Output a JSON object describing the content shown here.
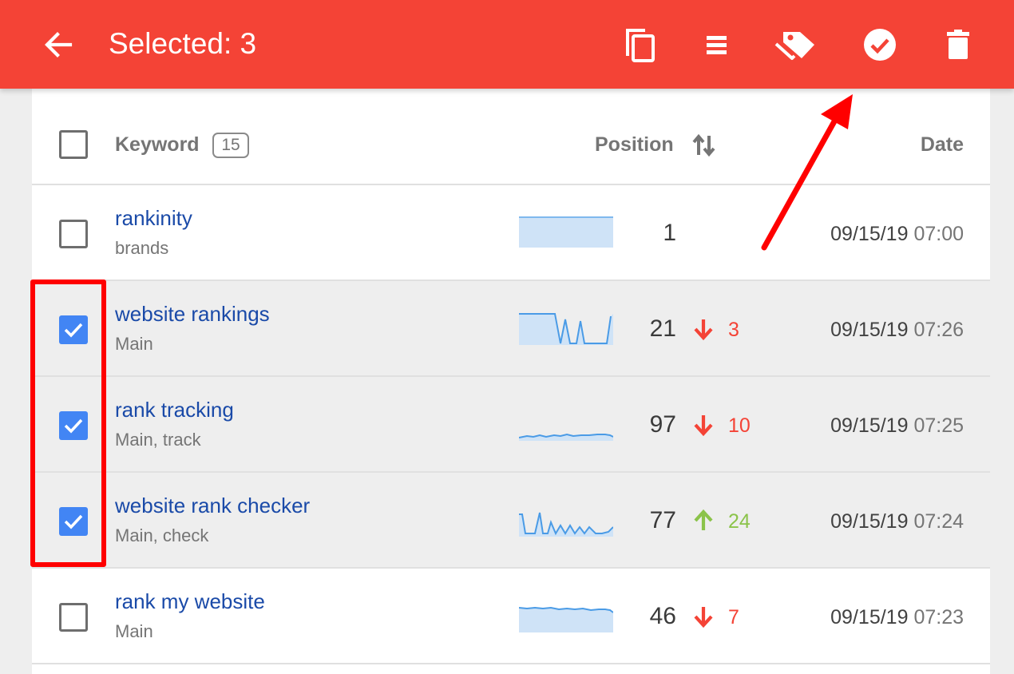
{
  "toolbar": {
    "title": "Selected: 3",
    "background": "#f44336",
    "icons": [
      "back-arrow-icon",
      "copy-icon",
      "list-icon",
      "tag-icon",
      "check-circle-icon",
      "trash-icon"
    ]
  },
  "table": {
    "header": {
      "keyword_label": "Keyword",
      "keyword_count": "15",
      "position_label": "Position",
      "date_label": "Date"
    },
    "rows": [
      {
        "keyword": "rankinity",
        "tags": "brands",
        "position": "1",
        "change": "",
        "direction": "none",
        "date": "09/15/19",
        "time": "07:00",
        "selected": false
      },
      {
        "keyword": "website rankings",
        "tags": "Main",
        "position": "21",
        "change": "3",
        "direction": "down",
        "date": "09/15/19",
        "time": "07:26",
        "selected": true
      },
      {
        "keyword": "rank tracking",
        "tags": "Main, track",
        "position": "97",
        "change": "10",
        "direction": "down",
        "date": "09/15/19",
        "time": "07:25",
        "selected": true
      },
      {
        "keyword": "website rank checker",
        "tags": "Main, check",
        "position": "77",
        "change": "24",
        "direction": "up",
        "date": "09/15/19",
        "time": "07:24",
        "selected": true
      },
      {
        "keyword": "rank my website",
        "tags": "Main",
        "position": "46",
        "change": "7",
        "direction": "down",
        "date": "09/15/19",
        "time": "07:23",
        "selected": false
      }
    ]
  },
  "colors": {
    "accent_red": "#f44336",
    "checkbox_blue": "#4285f4",
    "keyword_link": "#1a4aa8",
    "change_down": "#f44336",
    "change_up": "#8bc34a",
    "annotation": "#ff0000"
  }
}
